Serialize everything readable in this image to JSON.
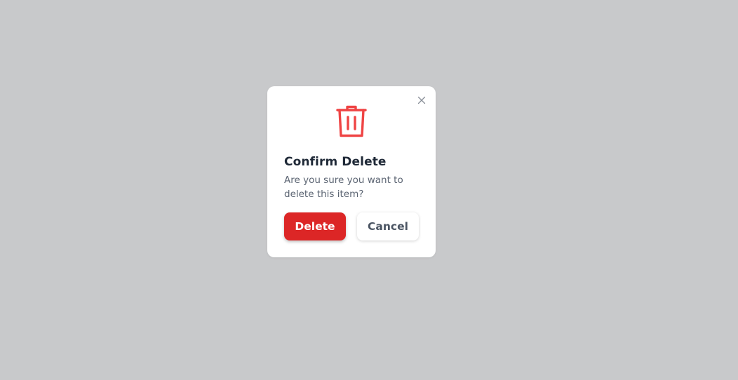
{
  "dialog": {
    "title": "Confirm Delete",
    "message": "Are you sure you want to delete this item?",
    "delete_label": "Delete",
    "cancel_label": "Cancel",
    "icons": {
      "main": "trash-icon",
      "close": "close-icon"
    }
  },
  "colors": {
    "backdrop": "#c8c9cb",
    "danger": "#dc2626",
    "icon": "#ef4444",
    "title": "#1f2937",
    "text": "#5b6472"
  }
}
